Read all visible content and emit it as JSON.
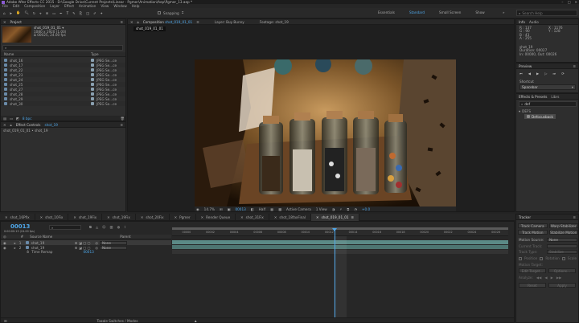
{
  "titlebar": {
    "title": "Adobe After Effects CC 2015 - D:\\Google Drive\\Current Projects\\Linear - Pgmer\\Animation\\Aep\\Pgmer_13.aep *"
  },
  "menu": [
    "File",
    "Edit",
    "Composition",
    "Layer",
    "Effect",
    "Animation",
    "View",
    "Window",
    "Help"
  ],
  "toolbar": {
    "snapping": "Snapping"
  },
  "workspaces": [
    "Essentials",
    "Standard",
    "Small Screen",
    "Show"
  ],
  "workspace_active": "Standard",
  "search_help": "Search Help",
  "project": {
    "title": "Project",
    "item_name": "shot_019_01_01 ▾",
    "item_info1": "1080 x 1920 (1.00)",
    "item_info2": "Δ 00025, 24.00 fps",
    "col_name": "Name",
    "col_type": "Type",
    "items": [
      {
        "name": "shot_16",
        "type": "JPEG Se...ce"
      },
      {
        "name": "shot_17",
        "type": "JPEG Se...ce"
      },
      {
        "name": "shot_22",
        "type": "JPEG Se...ce"
      },
      {
        "name": "shot_23",
        "type": "JPEG Se...ce"
      },
      {
        "name": "shot_24",
        "type": "JPEG Se...ce"
      },
      {
        "name": "shot_25",
        "type": "JPEG Se...ce"
      },
      {
        "name": "shot_27",
        "type": "JPEG Se...ce"
      },
      {
        "name": "shot_28",
        "type": "JPEG Se...ce"
      },
      {
        "name": "shot_29",
        "type": "JPEG Se...ce"
      },
      {
        "name": "shot_30",
        "type": "JPEG Se...ce"
      }
    ],
    "bpc": "8 bpc"
  },
  "effect_controls": {
    "title": "Effect Controls",
    "layer": "shot_19",
    "sub": "shot_019_01_01 • shot_19"
  },
  "composition": {
    "title": "Composition",
    "comp_name": "shot_019_01_01",
    "other_tabs": [
      "Layer: Buy Bunny",
      "Footage: shot_19"
    ],
    "comp_tab": "shot_019_01_01",
    "footer": {
      "zoom": "14.7%",
      "timecode": "00013",
      "resolution": "Half",
      "camera": "Active Camera",
      "views": "1 View",
      "exposure": "+0.0"
    }
  },
  "info": {
    "title": "Info",
    "audio": "Audio",
    "r": "R : 137",
    "g": "G : 90",
    "b": "B : 43",
    "a": "A : 255",
    "x": "X : 1176",
    "y": "Y : 128",
    "l1": "shot_19",
    "l2": "Duration: 00027",
    "l3": "In: 00000, Out: 00026"
  },
  "preview": {
    "title": "Preview",
    "shortcut_label": "Shortcut",
    "shortcut_value": "Spacebar"
  },
  "effects_presets": {
    "title": "Effects & Presets",
    "libs": "Librs",
    "search": "def",
    "category": "DEFS",
    "result": "Defocusback"
  },
  "tracker": {
    "title": "Tracker",
    "buttons": [
      "Track Camera",
      "Warp Stabilizer",
      "Track Motion",
      "Stabilize Motion"
    ],
    "motion_source": "Motion Source:",
    "motion_source_v": "None",
    "current_track": "Current Track:",
    "track_type": "Track Type:",
    "track_type_v": "Stabilize",
    "checks": [
      "Position",
      "Rotation",
      "Scale"
    ],
    "motion_target": "Motion Target:",
    "edit_target": "Edit Target...",
    "options": "Options...",
    "analyze": "Analyze:",
    "reset": "Reset",
    "apply": "Apply"
  },
  "comp_tabs": [
    "shot_16Pfix",
    "shot_10Fix",
    "shot_19Fix",
    "shot_19Fix",
    "shot_20Fix",
    "Pgmer",
    "Render Queue",
    "shot_31Fix",
    "shot_18faxFinal",
    "shot_019_01_01"
  ],
  "timeline": {
    "timecode": "00013",
    "fps": "0:00:00:13 (24.00 fps)",
    "header": {
      "num": "#",
      "source": "Source Name",
      "parent": "Parent"
    },
    "layers": [
      {
        "num": "1",
        "name": "shot_19",
        "parent": "None"
      },
      {
        "num": "2",
        "name": "shot_19",
        "parent": "None"
      }
    ],
    "time_remap": "Time Remap",
    "time_remap_val": "00013",
    "ruler": [
      "00000",
      "00002",
      "00004",
      "00006",
      "00008",
      "00010",
      "00012",
      "00014",
      "00016",
      "00018",
      "00020",
      "00022",
      "00024",
      "00026"
    ],
    "footer": "Toggle Switches / Modes"
  }
}
